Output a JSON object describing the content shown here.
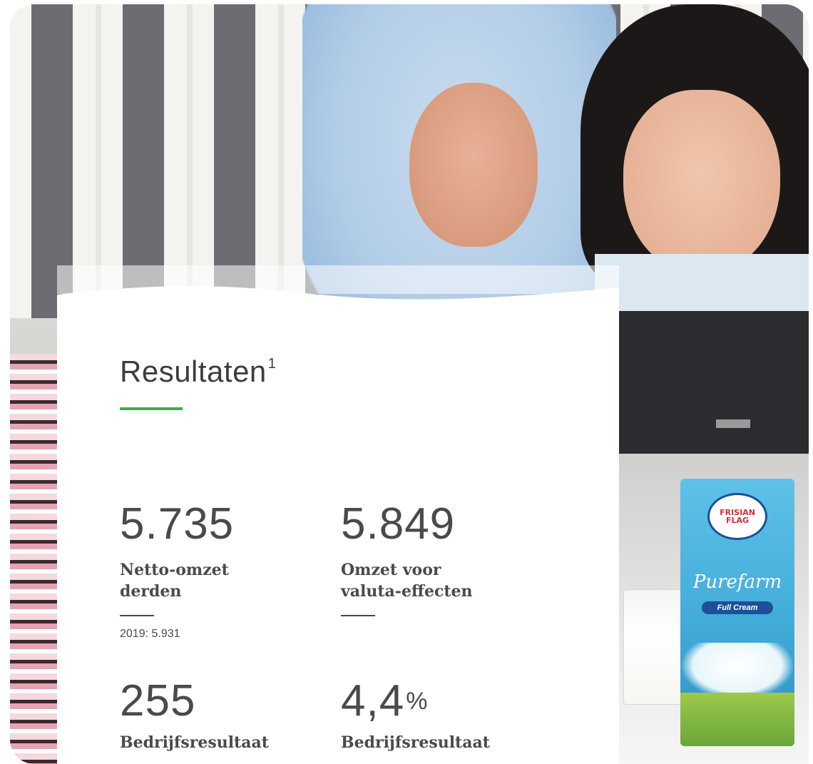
{
  "card": {
    "title": "Resultaten",
    "title_footnote": "1"
  },
  "kpis": [
    {
      "value": "5.735",
      "unit": "",
      "label_line1": "Netto-omzet",
      "label_line2": "derden",
      "compare": "2019: 5.931"
    },
    {
      "value": "5.849",
      "unit": "",
      "label_line1": "Omzet voor",
      "label_line2": "valuta-effecten",
      "compare": ""
    },
    {
      "value": "255",
      "unit": "",
      "label_line1": "Bedrijfsresultaat",
      "label_line2": "",
      "compare": ""
    },
    {
      "value": "4,4",
      "unit": "%",
      "label_line1": "Bedrijfsresultaat",
      "label_line2": "",
      "compare": ""
    }
  ],
  "product": {
    "logo_text": "FRISIAN FLAG",
    "name": "Purefarm",
    "variant": "Full Cream"
  },
  "colors": {
    "accent_green": "#3dad48",
    "text": "#4a4a4a",
    "milk_box_blue": "#41abd9"
  },
  "icons": {
    "title_rule": "green-underline-decoration",
    "kpi_rule": "dark-short-divider"
  }
}
